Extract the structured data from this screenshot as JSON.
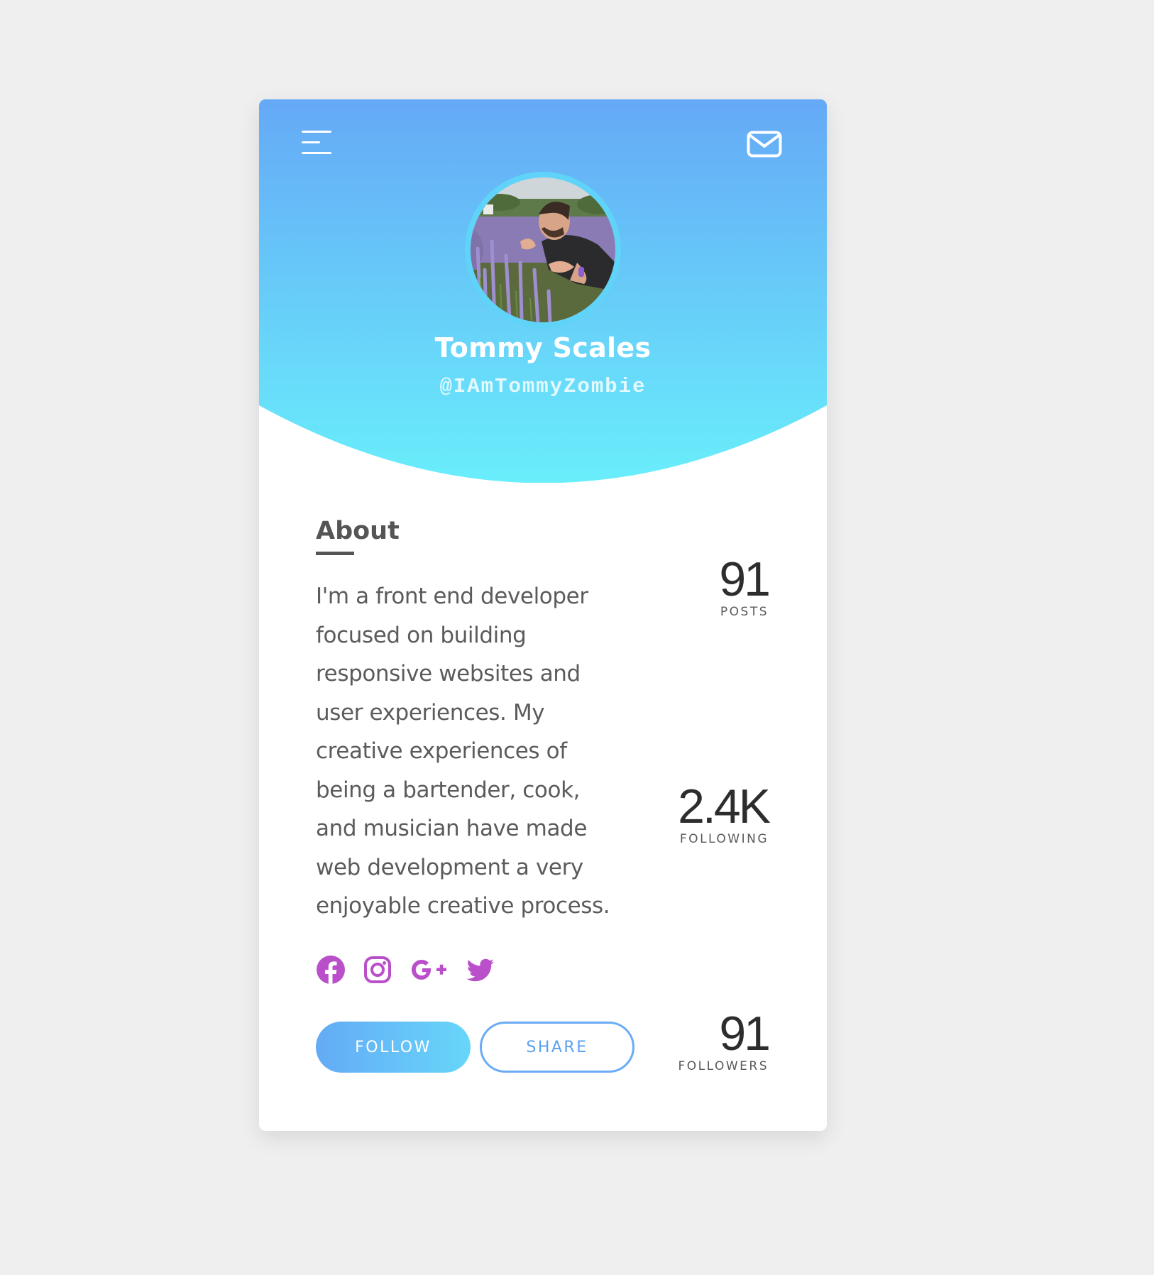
{
  "profile": {
    "name": "Tommy Scales",
    "handle": "@IAmTommyZombie"
  },
  "about": {
    "title": "About",
    "lines": [
      "I'm a front end developer",
      "focused on building",
      "responsive websites and",
      "user experiences. My",
      "creative experiences of",
      "being a bartender, cook,",
      "and musician have made",
      "web development a very",
      "enjoyable creative process."
    ]
  },
  "social_icons": [
    "facebook-icon",
    "instagram-icon",
    "google-plus-icon",
    "twitter-icon"
  ],
  "actions": {
    "follow_label": "FOLLOW",
    "share_label": "SHARE"
  },
  "stats": [
    {
      "value": "91",
      "label": "POSTS"
    },
    {
      "value": "2.4K",
      "label": "FOLLOWING"
    },
    {
      "value": "91",
      "label": "FOLLOWERS"
    }
  ],
  "colors": {
    "header_top": "#65a9f6",
    "header_bottom": "#69eefb",
    "social_accent": "#b94fc9",
    "text": "#5b5b5b",
    "background": "#efefef"
  }
}
